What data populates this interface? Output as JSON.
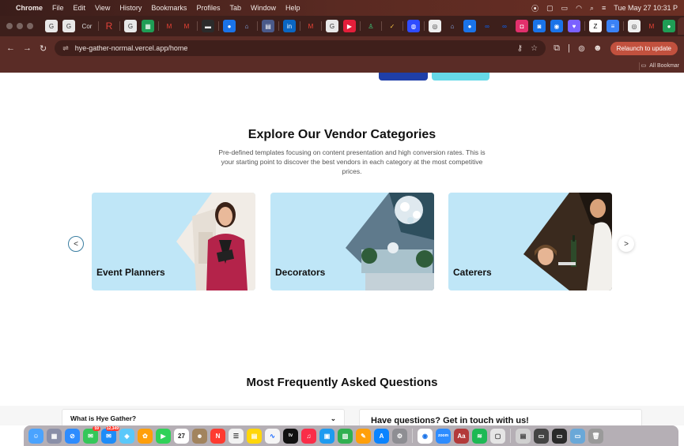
{
  "menubar": {
    "app": "Chrome",
    "items": [
      "File",
      "Edit",
      "View",
      "History",
      "Bookmarks",
      "Profiles",
      "Tab",
      "Window",
      "Help"
    ],
    "clock": "Tue May 27  10:31 P"
  },
  "tabs": {
    "first_tab_label": "Cor",
    "active_tab_close": "×",
    "new_tab": "+"
  },
  "toolbar": {
    "url": "hye-gather-normal.vercel.app/home",
    "relaunch_label": "Relaunch to update"
  },
  "bookmarks": {
    "all_label": "All Bookmar"
  },
  "vendors": {
    "title": "Explore Our Vendor Categories",
    "description": "Pre-defined templates focusing on content presentation and high conversion rates. This is your starting point to discover the best vendors in each category at the most competitive prices.",
    "categories": [
      {
        "label": "Event Planners"
      },
      {
        "label": "Decorators"
      },
      {
        "label": "Caterers"
      }
    ],
    "prev_label": "<",
    "next_label": ">"
  },
  "faq": {
    "title": "Most Frequently Asked Questions",
    "first_question": "What is Hye Gather?",
    "contact_heading": "Have questions? Get in touch with us!"
  },
  "dock": {
    "calendar_day": "27",
    "mail_badge": "12,349",
    "messages_badge": "59"
  },
  "colors": {
    "card_bg": "#bfe6f7",
    "hero_primary": "#1f3fa8",
    "hero_secondary": "#66d9e8",
    "browser_frame": "#5a2c26"
  }
}
